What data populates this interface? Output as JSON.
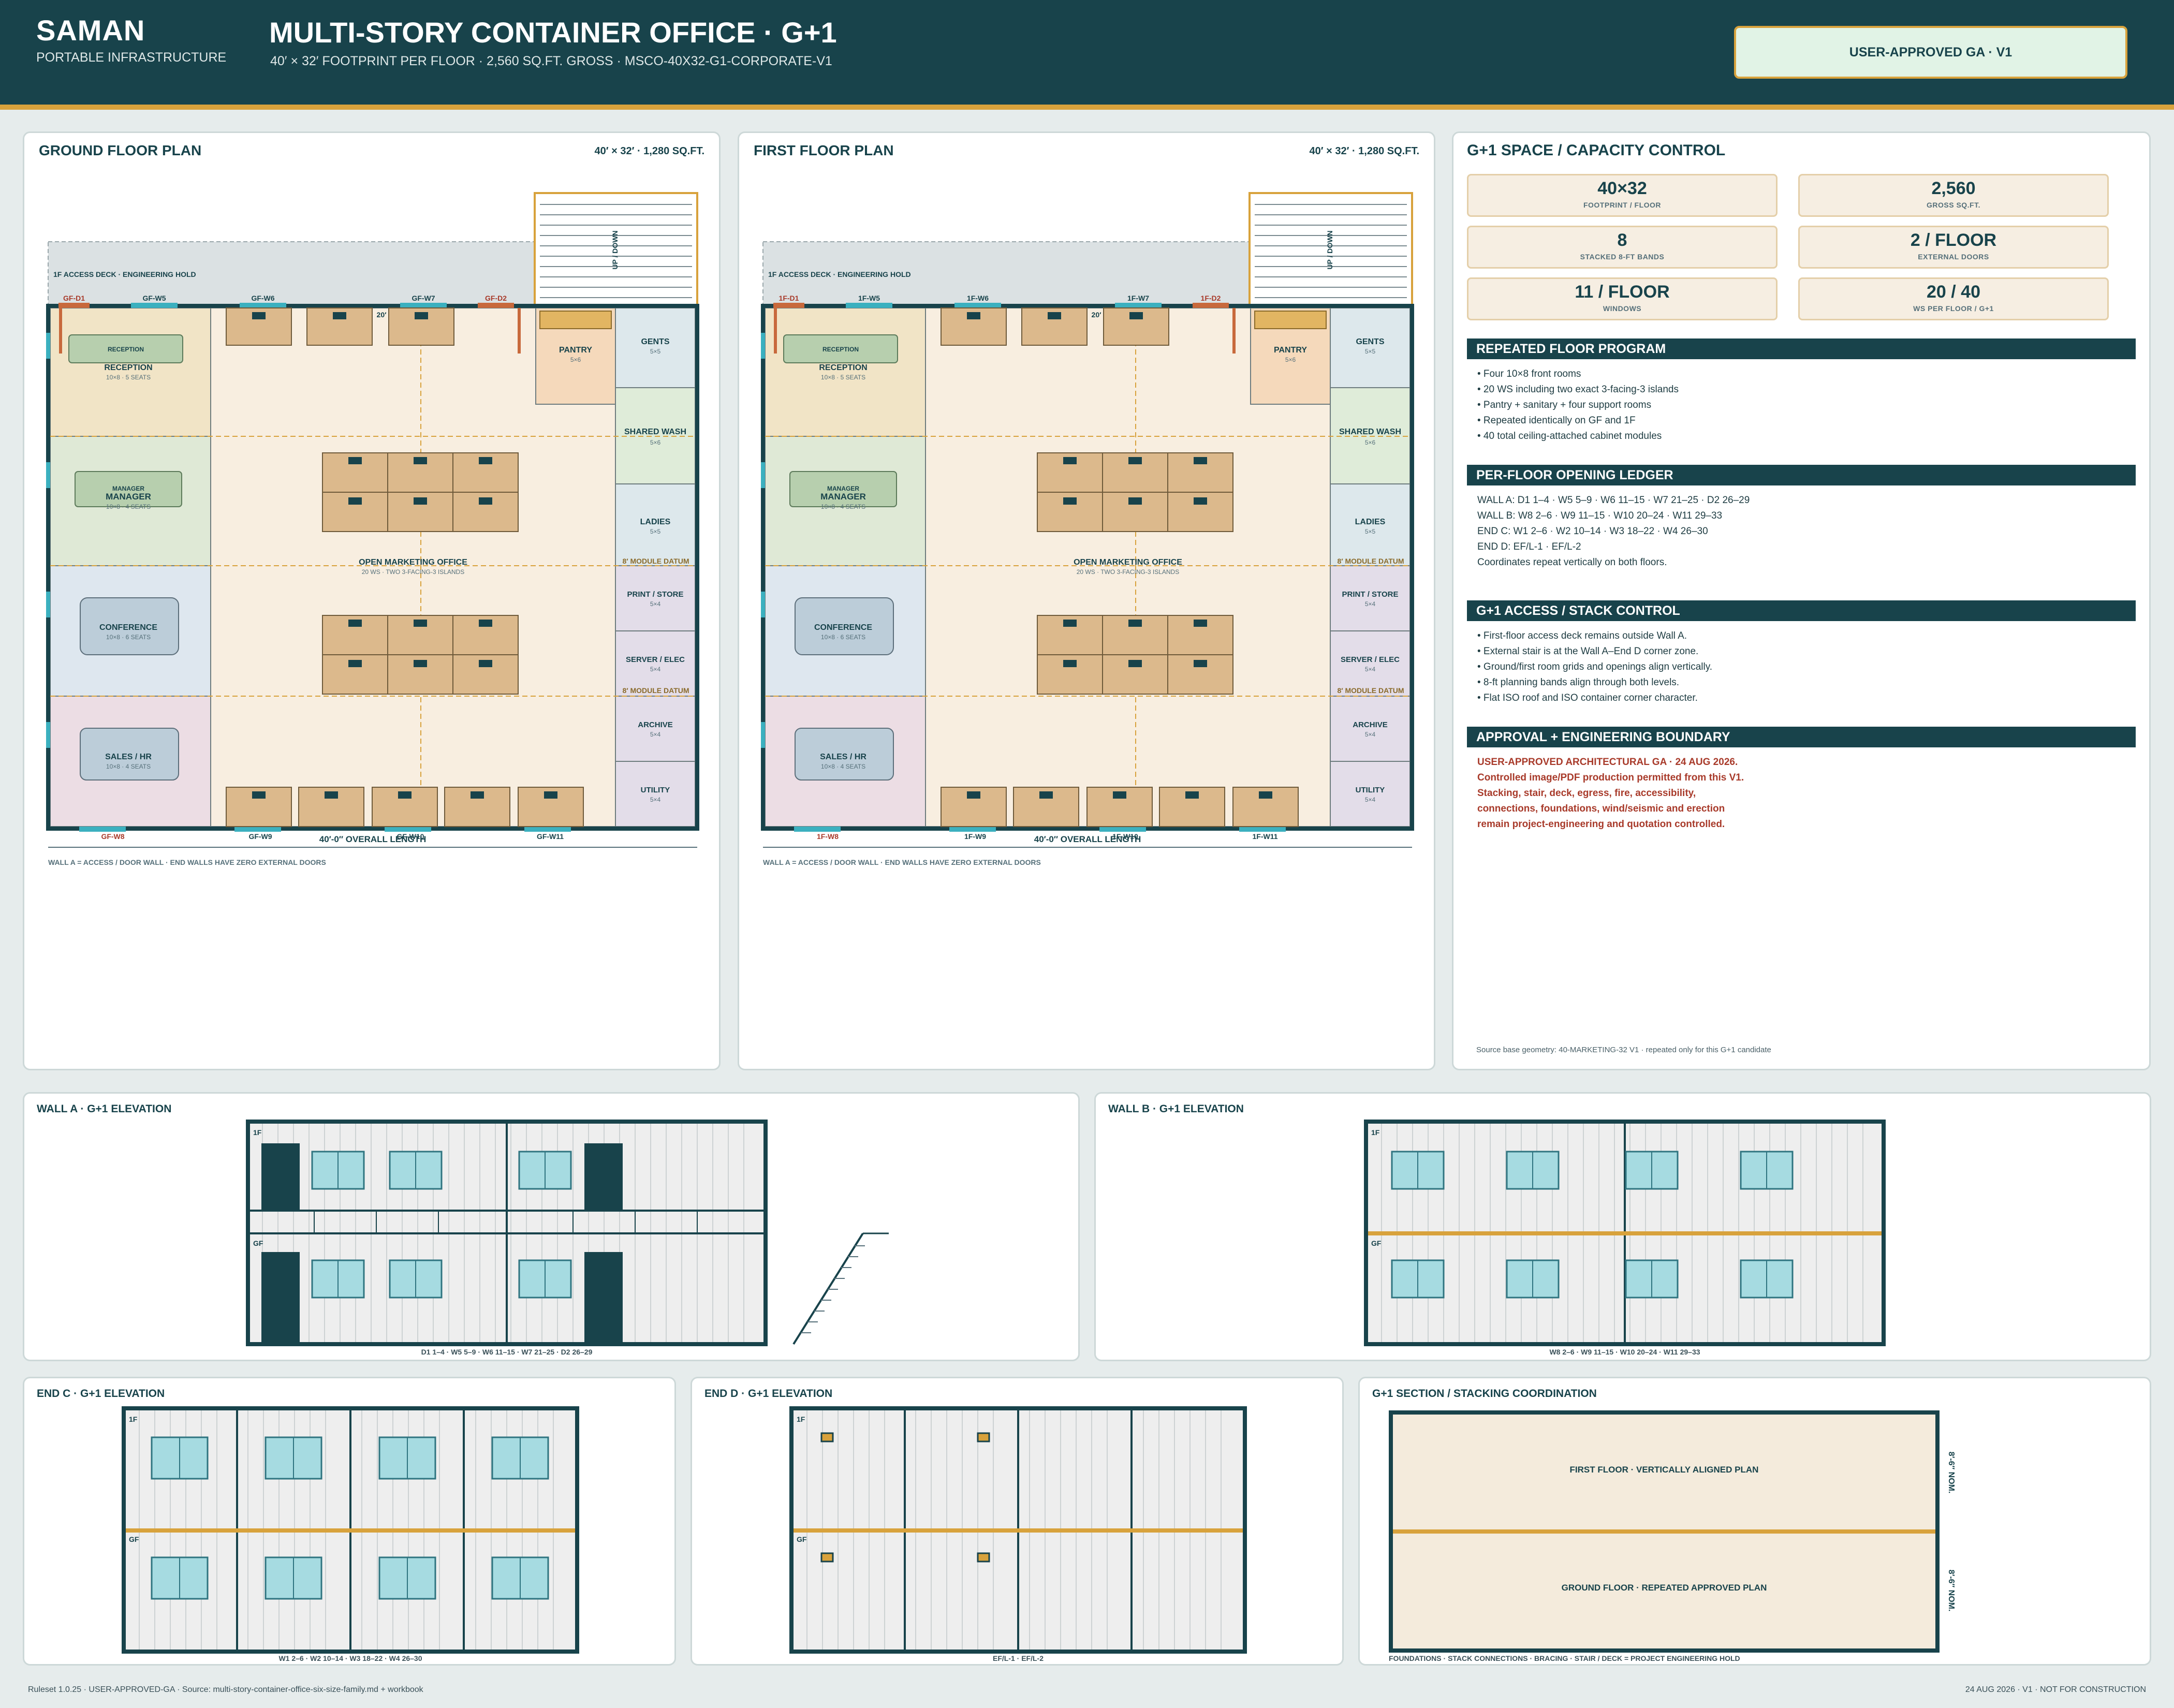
{
  "header": {
    "brand": "SAMAN",
    "brand_sub": "PORTABLE INFRASTRUCTURE",
    "title": "MULTI-STORY CONTAINER OFFICE · G+1",
    "subtitle": "40′ × 32′ FOOTPRINT PER FLOOR · 2,560 SQ.FT. GROSS · MSCO-40X32-G1-CORPORATE-V1",
    "badge": "USER-APPROVED GA · V1"
  },
  "ground_plan": {
    "title": "GROUND FLOOR PLAN",
    "meta": "40′ × 32′ · 1,280 SQ.FT.",
    "deck": "1F ACCESS DECK · ENGINEERING HOLD",
    "stair": "UP / DOWN",
    "rooms": {
      "reception_tag": "RECEPTION",
      "reception": "RECEPTION",
      "reception_sub": "10×8 · 5 SEATS",
      "manager_tag": "MANAGER",
      "manager": "MANAGER",
      "manager_sub": "10×8 · 4 SEATS",
      "conference": "CONFERENCE",
      "conference_sub": "10×8 · 6 SEATS",
      "sales": "SALES / HR",
      "sales_sub": "10×8 · 4 SEATS",
      "pantry": "PANTRY",
      "pantry_sub": "5×6",
      "gents": "GENTS",
      "gents_sub": "5×5",
      "shared_wash": "SHARED WASH",
      "shared_wash_sub": "5×6",
      "ladies": "LADIES",
      "ladies_sub": "5×5",
      "print": "PRINT / STORE",
      "print_sub": "5×4",
      "server": "SERVER / ELEC",
      "server_sub": "5×4",
      "archive": "ARCHIVE",
      "archive_sub": "5×4",
      "utility": "UTILITY",
      "utility_sub": "5×4",
      "open_office": "OPEN MARKETING OFFICE",
      "open_office_sub": "20 WS · TWO 3-FACING-3 ISLANDS"
    },
    "datum": "8′ MODULE DATUM",
    "dim_20": "20′",
    "tags": {
      "d1": "GF-D1",
      "w5": "GF-W5",
      "w6": "GF-W6",
      "w7": "GF-W7",
      "d2": "GF-D2",
      "w8": "GF-W8",
      "w9": "GF-W9",
      "w10": "GF-W10",
      "w11": "GF-W11"
    },
    "length": "40′-0″ OVERALL LENGTH",
    "note": "WALL A = ACCESS / DOOR WALL · END WALLS HAVE ZERO EXTERNAL DOORS"
  },
  "first_plan": {
    "title": "FIRST FLOOR PLAN",
    "meta": "40′ × 32′ · 1,280 SQ.FT.",
    "deck": "1F ACCESS DECK · ENGINEERING HOLD",
    "stair": "UP / DOWN",
    "rooms": {
      "reception_tag": "RECEPTION",
      "reception": "RECEPTION",
      "reception_sub": "10×8 · 5 SEATS",
      "manager_tag": "MANAGER",
      "manager": "MANAGER",
      "manager_sub": "10×8 · 4 SEATS",
      "conference": "CONFERENCE",
      "conference_sub": "10×8 · 6 SEATS",
      "sales": "SALES / HR",
      "sales_sub": "10×8 · 4 SEATS",
      "pantry": "PANTRY",
      "pantry_sub": "5×6",
      "gents": "GENTS",
      "gents_sub": "5×5",
      "shared_wash": "SHARED WASH",
      "shared_wash_sub": "5×6",
      "ladies": "LADIES",
      "ladies_sub": "5×5",
      "print": "PRINT / STORE",
      "print_sub": "5×4",
      "server": "SERVER / ELEC",
      "server_sub": "5×4",
      "archive": "ARCHIVE",
      "archive_sub": "5×4",
      "utility": "UTILITY",
      "utility_sub": "5×4",
      "open_office": "OPEN MARKETING OFFICE",
      "open_office_sub": "20 WS · TWO 3-FACING-3 ISLANDS"
    },
    "datum": "8′ MODULE DATUM",
    "dim_20": "20′",
    "tags": {
      "d1": "1F-D1",
      "w5": "1F-W5",
      "w6": "1F-W6",
      "w7": "1F-W7",
      "d2": "1F-D2",
      "w8": "1F-W8",
      "w9": "1F-W9",
      "w10": "1F-W10",
      "w11": "1F-W11"
    },
    "length": "40′-0″ OVERALL LENGTH",
    "note": "WALL A = ACCESS / DOOR WALL · END WALLS HAVE ZERO EXTERNAL DOORS"
  },
  "control": {
    "title": "G+1 SPACE / CAPACITY CONTROL",
    "metrics": [
      {
        "value": "40×32",
        "label": "FOOTPRINT / FLOOR"
      },
      {
        "value": "2,560",
        "label": "GROSS SQ.FT."
      },
      {
        "value": "8",
        "label": "STACKED 8-FT BANDS"
      },
      {
        "value": "2 / FLOOR",
        "label": "EXTERNAL DOORS"
      },
      {
        "value": "11 / FLOOR",
        "label": "WINDOWS"
      },
      {
        "value": "20 / 40",
        "label": "WS PER FLOOR / G+1"
      }
    ],
    "sections": [
      {
        "title": "REPEATED FLOOR PROGRAM",
        "items": [
          "• Four 10×8 front rooms",
          "• 20 WS including two exact 3-facing-3 islands",
          "• Pantry + sanitary + four support rooms",
          "• Repeated identically on GF and 1F",
          "• 40 total ceiling-attached cabinet modules"
        ]
      },
      {
        "title": "PER-FLOOR OPENING LEDGER",
        "items": [
          "WALL A: D1 1–4 · W5 5–9 · W6 11–15 · W7 21–25 · D2 26–29",
          "WALL B: W8 2–6 · W9 11–15 · W10 20–24 · W11 29–33",
          "END C: W1 2–6 · W2 10–14 · W3 18–22 · W4 26–30",
          "END D: EF/L-1 · EF/L-2",
          "Coordinates repeat vertically on both floors."
        ]
      },
      {
        "title": "G+1 ACCESS / STACK CONTROL",
        "items": [
          "• First-floor access deck remains outside Wall A.",
          "• External stair is at the Wall A–End D corner zone.",
          "• Ground/first room grids and openings align vertically.",
          "• 8-ft planning bands align through both levels.",
          "• Flat ISO roof and ISO container corner character."
        ]
      },
      {
        "title": "APPROVAL + ENGINEERING BOUNDARY",
        "items": [
          "USER-APPROVED ARCHITECTURAL GA · 24 AUG 2026.",
          "Controlled image/PDF production permitted from this V1.",
          "Stacking, stair, deck, egress, fire, accessibility,",
          "connections, foundations, wind/seismic and erection",
          "remain project-engineering and quotation controlled."
        ]
      }
    ],
    "source": "Source base geometry: 40-MARKETING-32 V1 · repeated only for this G+1 candidate"
  },
  "elevations": {
    "wall_a": {
      "title": "WALL A · G+1 ELEVATION",
      "caption": "D1 1–4 · W5 5–9 · W6 11–15 · W7 21–25 · D2 26–29",
      "f1": "1F",
      "gf": "GF"
    },
    "wall_b": {
      "title": "WALL B · G+1 ELEVATION",
      "caption": "W8 2–6 · W9 11–15 · W10 20–24 · W11 29–33",
      "f1": "1F",
      "gf": "GF"
    },
    "end_c": {
      "title": "END C · G+1 ELEVATION",
      "caption": "W1 2–6 · W2 10–14 · W3 18–22 · W4 26–30",
      "f1": "1F",
      "gf": "GF"
    },
    "end_d": {
      "title": "END D · G+1 ELEVATION",
      "caption": "EF/L-1 · EF/L-2",
      "f1": "1F",
      "gf": "GF"
    },
    "section": {
      "title": "G+1 SECTION / STACKING COORDINATION",
      "first": "FIRST FLOOR · VERTICALLY ALIGNED PLAN",
      "ground": "GROUND FLOOR · REPEATED APPROVED PLAN",
      "nom_top": "8′-6″ NOM.",
      "nom_bottom": "8′-6″ NOM.",
      "caption": "FOUNDATIONS · STACK CONNECTIONS · BRACING · STAIR / DECK = PROJECT ENGINEERING HOLD"
    }
  },
  "footer": {
    "left": "Ruleset 1.0.25 · USER-APPROVED-GA · Source: multi-story-container-office-six-size-family.md + workbook",
    "right": "24 AUG 2026 · V1 · NOT FOR CONSTRUCTION"
  },
  "colors": {
    "brand_dark": "#18434b",
    "accent_gold": "#d8a23c",
    "door_orange": "#c8693c",
    "window_cyan": "#9fd6dc",
    "warning_red": "#a83a2a"
  }
}
